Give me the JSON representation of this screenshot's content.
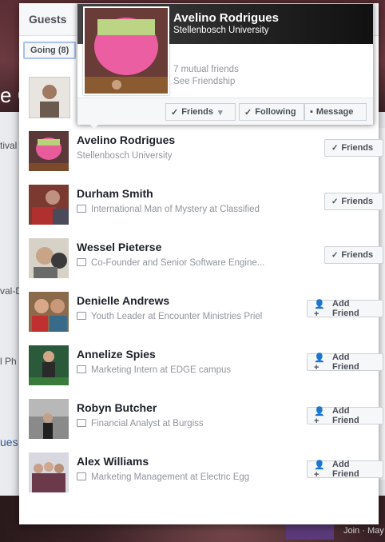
{
  "modal": {
    "title": "Guests",
    "filter_label": "Going (8)"
  },
  "hovercard": {
    "name": "Avelino Rodrigues",
    "subtitle": "Stellenbosch University",
    "mutual": "7 mutual friends",
    "see_friendship": "See Friendship",
    "friends_btn": "Friends",
    "following_btn": "Following",
    "message_btn": "Message"
  },
  "guests": [
    {
      "name": "Avelino Rodrigues",
      "detail": "Stellenbosch University",
      "work_icon": false,
      "button": "Friends",
      "btn_type": "friends"
    },
    {
      "name": "Durham Smith",
      "detail": "International Man of Mystery at Classified",
      "work_icon": true,
      "button": "Friends",
      "btn_type": "friends"
    },
    {
      "name": "Wessel Pieterse",
      "detail": "Co-Founder and Senior Software Engine...",
      "work_icon": true,
      "button": "Friends",
      "btn_type": "friends"
    },
    {
      "name": "Denielle Andrews",
      "detail": "Youth Leader at Encounter Ministries Priel",
      "work_icon": true,
      "button": "Add Friend",
      "btn_type": "add"
    },
    {
      "name": "Annelize Spies",
      "detail": "Marketing Intern at EDGE campus",
      "work_icon": true,
      "button": "Add Friend",
      "btn_type": "add"
    },
    {
      "name": "Robyn Butcher",
      "detail": "Financial Analyst at Burgiss",
      "work_icon": true,
      "button": "Add Friend",
      "btn_type": "add"
    },
    {
      "name": "Alex Williams",
      "detail": "Marketing Management at Electric Egg",
      "work_icon": true,
      "button": "Add Friend",
      "btn_type": "add"
    }
  ],
  "background": {
    "left_fragments": [
      "e C",
      "tival",
      "val-D",
      "l Ph",
      "ues"
    ],
    "bottom_right": "Join · May"
  }
}
